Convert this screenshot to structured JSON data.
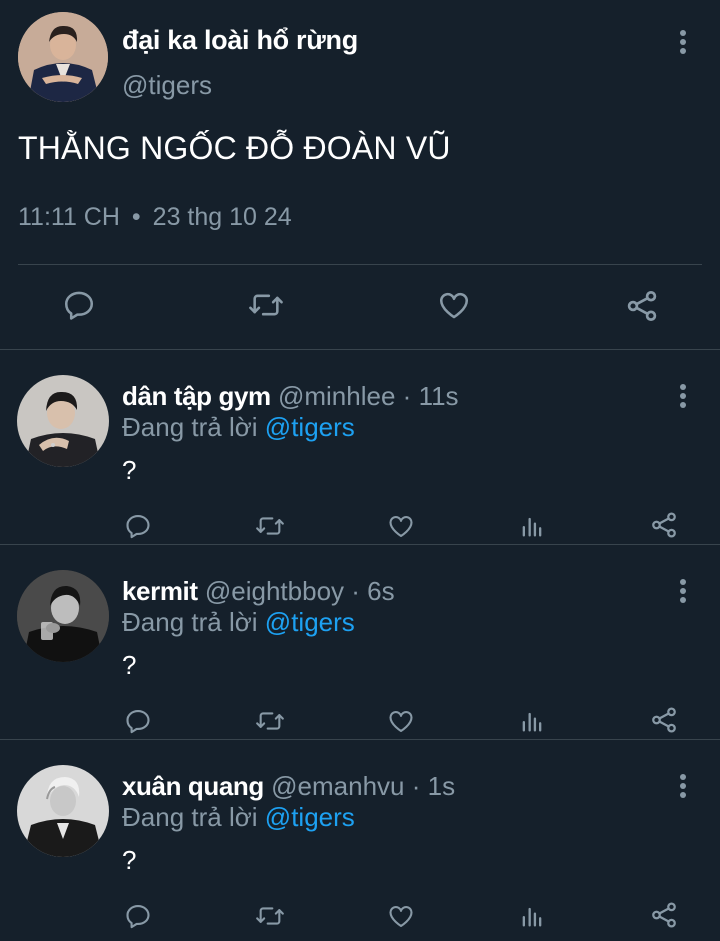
{
  "main_tweet": {
    "author_name": "đại ka loài hổ rừng",
    "author_handle": "@tigers",
    "text": "THẰNG NGỐC ĐỖ ĐOÀN VŨ",
    "time": "11:11 CH",
    "separator": "•",
    "date": "23 thg 10 24",
    "actions": [
      "reply-icon",
      "retweet-icon",
      "like-icon",
      "share-icon"
    ]
  },
  "replies": [
    {
      "name": "dân tập gym",
      "handle": "@minhlee",
      "separator": "·",
      "time": "11s",
      "replying_prefix": "Đang trả lời",
      "replying_to": "@tigers",
      "text": "?"
    },
    {
      "name": "kermit",
      "handle": "@eightbboy",
      "separator": "·",
      "time": "6s",
      "replying_prefix": "Đang trả lời",
      "replying_to": "@tigers",
      "text": "?"
    },
    {
      "name": "xuân quang",
      "handle": "@emanhvu",
      "separator": "·",
      "time": "1s",
      "replying_prefix": "Đang trả lời",
      "replying_to": "@tigers",
      "text": "?"
    }
  ],
  "reply_actions": [
    "reply-icon",
    "retweet-icon",
    "like-icon",
    "analytics-icon",
    "share-icon"
  ],
  "colors": {
    "background": "#15202b",
    "divider": "#38444d",
    "secondary_text": "#8899a6",
    "mention": "#1da1f2"
  }
}
